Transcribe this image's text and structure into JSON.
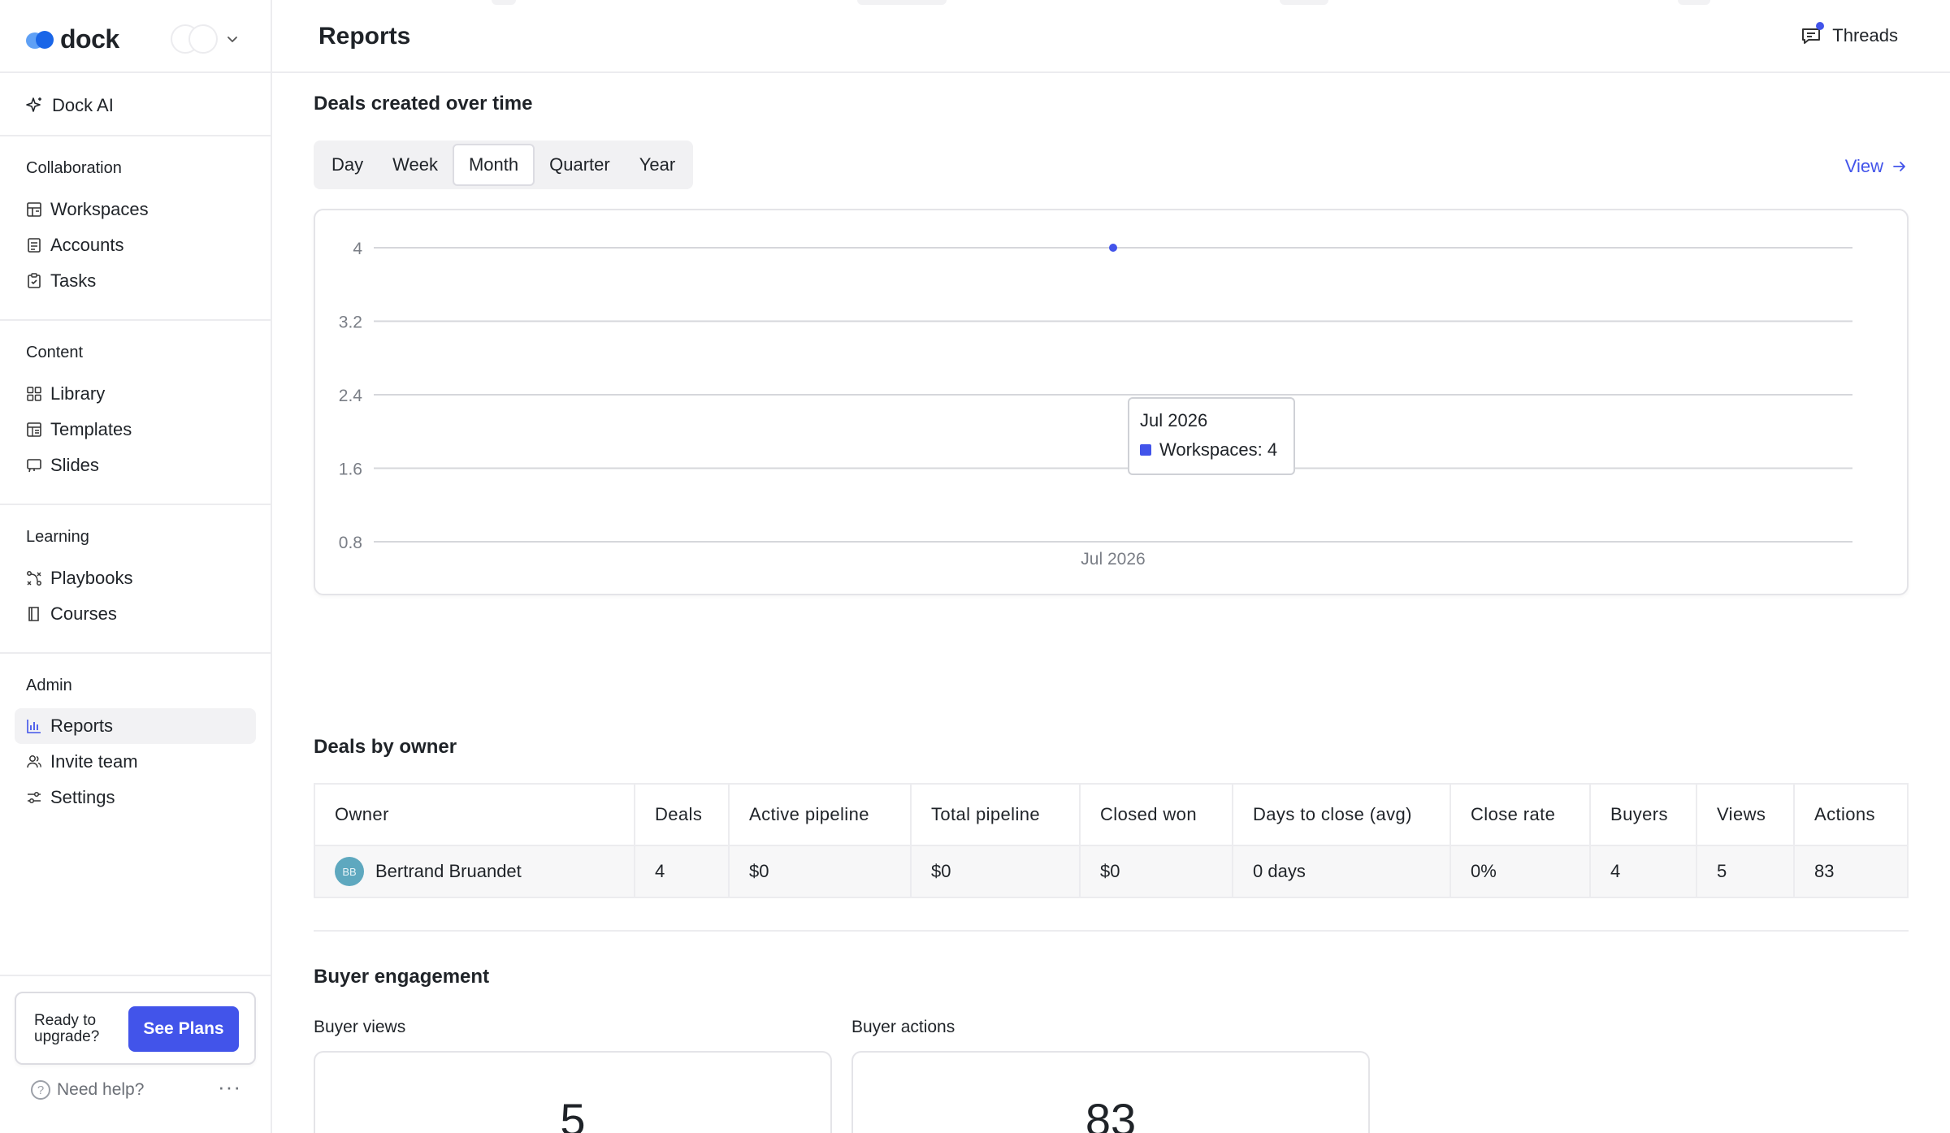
{
  "app": {
    "logo_text": "dock"
  },
  "sidebar": {
    "ai_label": "Dock AI",
    "sections": [
      {
        "label": "Collaboration",
        "items": [
          {
            "label": "Workspaces",
            "icon": "workspaces-icon"
          },
          {
            "label": "Accounts",
            "icon": "accounts-icon"
          },
          {
            "label": "Tasks",
            "icon": "tasks-icon"
          }
        ]
      },
      {
        "label": "Content",
        "items": [
          {
            "label": "Library",
            "icon": "library-icon"
          },
          {
            "label": "Templates",
            "icon": "templates-icon"
          },
          {
            "label": "Slides",
            "icon": "slides-icon"
          }
        ]
      },
      {
        "label": "Learning",
        "items": [
          {
            "label": "Playbooks",
            "icon": "playbooks-icon"
          },
          {
            "label": "Courses",
            "icon": "courses-icon"
          }
        ]
      },
      {
        "label": "Admin",
        "items": [
          {
            "label": "Reports",
            "icon": "bar-chart-icon",
            "active": true
          },
          {
            "label": "Invite team",
            "icon": "users-icon"
          },
          {
            "label": "Settings",
            "icon": "sliders-icon"
          }
        ]
      }
    ],
    "upgrade": {
      "text": "Ready to upgrade?",
      "button": "See Plans"
    },
    "help_label": "Need help?",
    "more_label": "···"
  },
  "header": {
    "title": "Reports",
    "threads_label": "Threads"
  },
  "deals_over_time": {
    "title": "Deals created over time",
    "periods": [
      "Day",
      "Week",
      "Month",
      "Quarter",
      "Year"
    ],
    "selected_period": "Month",
    "view_label": "View",
    "tooltip": {
      "title": "Jul 2026",
      "series_label": "Workspaces: 4"
    }
  },
  "chart_data": {
    "type": "line",
    "x": [
      "Jul 2026"
    ],
    "series": [
      {
        "name": "Workspaces",
        "values": [
          4
        ]
      }
    ],
    "yticks": [
      "0.8",
      "1.6",
      "2.4",
      "3.2",
      "4"
    ],
    "ylim": [
      0.8,
      4
    ],
    "xlabel": "",
    "ylabel": "",
    "grid": true,
    "color": "#4254ea"
  },
  "deals_by_owner": {
    "title": "Deals by owner",
    "columns": [
      "Owner",
      "Deals",
      "Active pipeline",
      "Total pipeline",
      "Closed won",
      "Days to close (avg)",
      "Close rate",
      "Buyers",
      "Views",
      "Actions"
    ],
    "rows": [
      {
        "initials": "BB",
        "cells": [
          "Bertrand Bruandet",
          "4",
          "$0",
          "$0",
          "$0",
          "0 days",
          "0%",
          "4",
          "5",
          "83"
        ]
      }
    ]
  },
  "buyer_engagement": {
    "title": "Buyer engagement",
    "views_label": "Buyer views",
    "views_value": "5",
    "actions_label": "Buyer actions",
    "actions_value": "83"
  }
}
